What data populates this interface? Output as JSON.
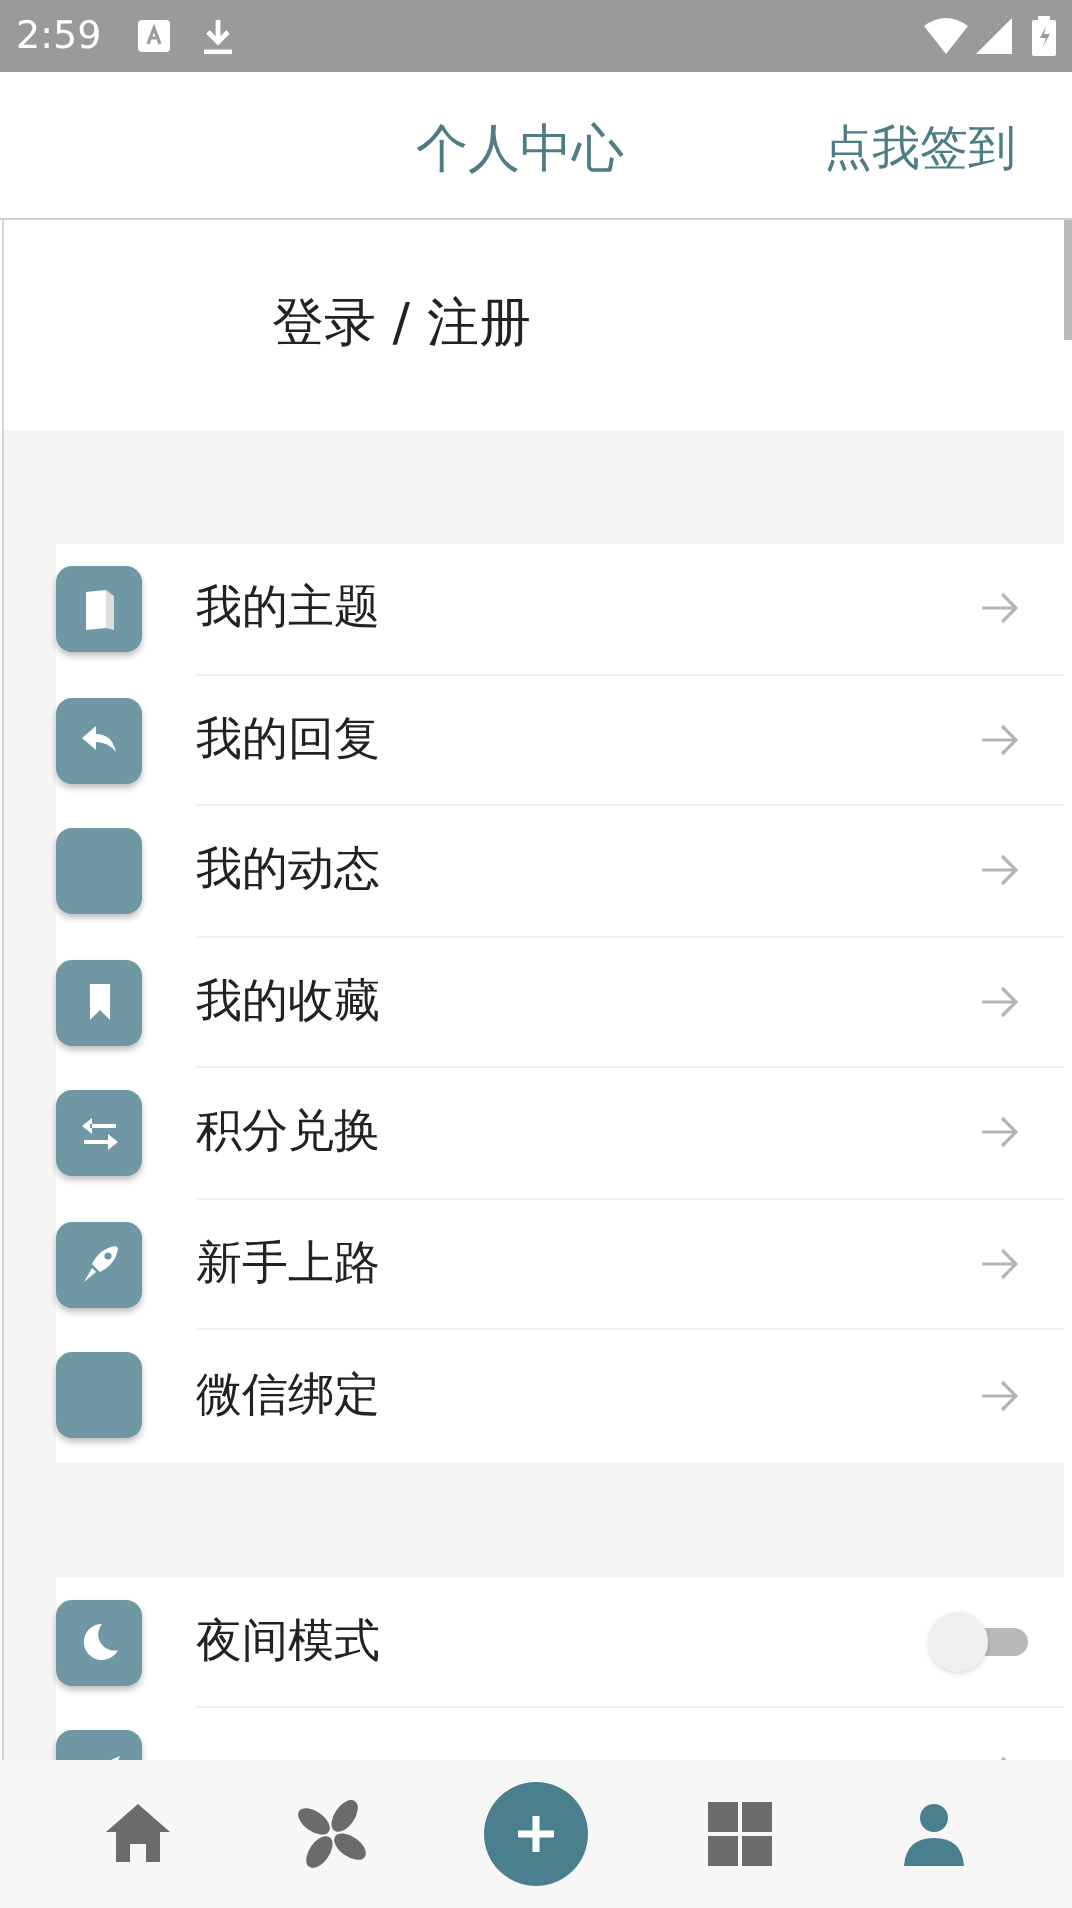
{
  "status_bar": {
    "time": "2:59"
  },
  "header": {
    "title": "个人中心",
    "action": "点我签到"
  },
  "login": {
    "label": "登录 / 注册"
  },
  "menu": [
    {
      "label": "我的主题",
      "kind": "link"
    },
    {
      "label": "我的回复",
      "kind": "link"
    },
    {
      "label": "我的动态",
      "kind": "link"
    },
    {
      "label": "我的收藏",
      "kind": "link"
    },
    {
      "label": "积分兑换",
      "kind": "link"
    },
    {
      "label": "新手上路",
      "kind": "link"
    },
    {
      "label": "微信绑定",
      "kind": "link"
    }
  ],
  "settings": [
    {
      "label": "夜间模式",
      "kind": "toggle",
      "on": false
    },
    {
      "kind": "link"
    }
  ],
  "bottom_nav": [
    {
      "kind": "tab",
      "selected": false
    },
    {
      "kind": "tab",
      "selected": false
    },
    {
      "kind": "add"
    },
    {
      "kind": "tab",
      "selected": false
    },
    {
      "kind": "tab",
      "selected": true
    }
  ]
}
